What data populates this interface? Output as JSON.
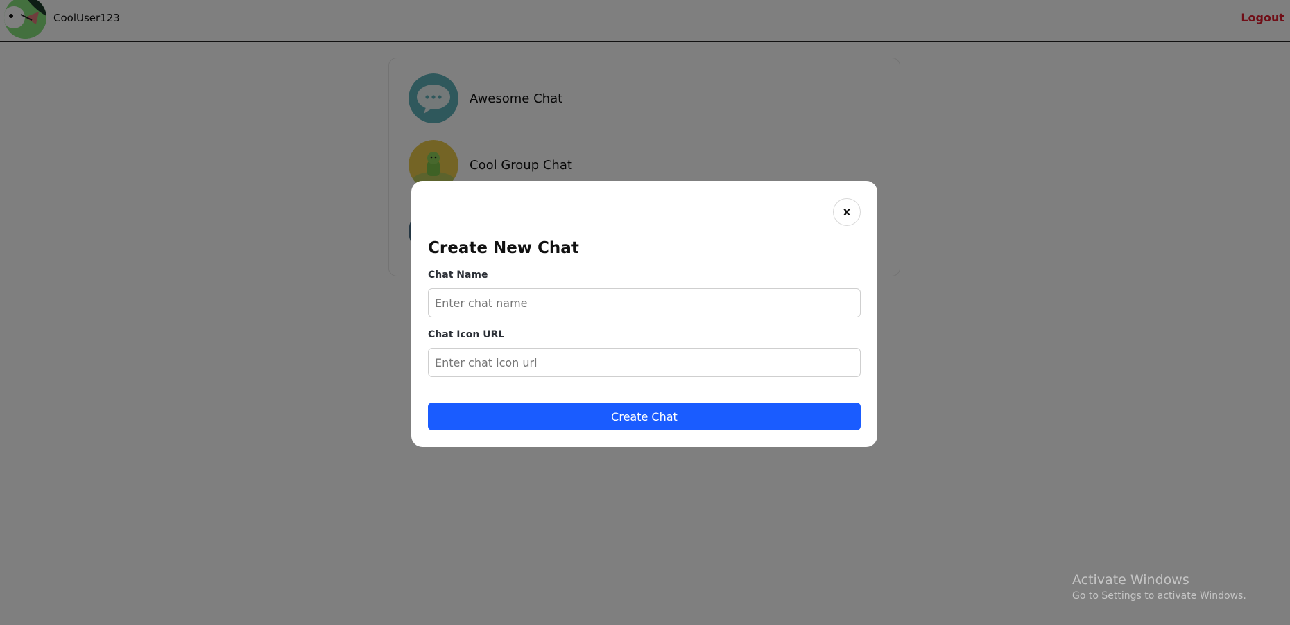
{
  "header": {
    "username": "CoolUser123",
    "logout_label": "Logout"
  },
  "chats": [
    {
      "name": "Awesome Chat",
      "icon": "speech-bubble-icon"
    },
    {
      "name": "Cool Group Chat",
      "icon": "android-figure-icon"
    },
    {
      "name": "",
      "icon": "chat-avatar-partial"
    }
  ],
  "modal": {
    "close_label": "x",
    "title": "Create New Chat",
    "name_label": "Chat Name",
    "name_placeholder": "Enter chat name",
    "name_value": "",
    "icon_label": "Chat Icon URL",
    "icon_placeholder": "Enter chat icon url",
    "icon_value": "",
    "submit_label": "Create Chat"
  },
  "watermark": {
    "title": "Activate Windows",
    "subtitle": "Go to Settings to activate Windows."
  },
  "colors": {
    "accent": "#1a5cff",
    "logout": "#e11d2e",
    "overlay": "rgba(0,0,0,0.5)"
  }
}
